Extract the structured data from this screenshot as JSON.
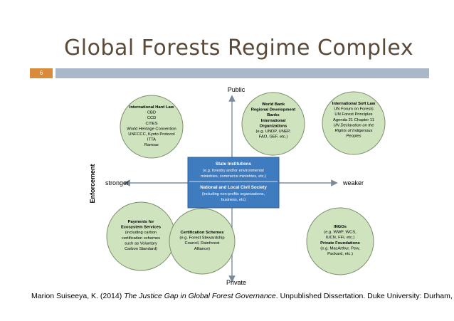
{
  "slide": {
    "title": "Global Forests Regime Complex",
    "number": "6",
    "citation_author": "Marion Suiseeya, K. (2014) ",
    "citation_title": "The Justice Gap in Global Forest Governance",
    "citation_rest": ". Unpublished Dissertation. Duke University: Durham, NC."
  },
  "diagram": {
    "axis_labels": {
      "top": "Public",
      "bottom": "Private",
      "left": "stronger",
      "right": "weaker",
      "vertical": "Enforcement"
    },
    "center_box": {
      "top_title": "State Institutions",
      "top_lines": [
        "(e.g. forestry and/or environmental",
        "ministries, commerce ministries, etc.)"
      ],
      "bottom_title": "National and Local Civil Society",
      "bottom_lines": [
        "(including non-profits organizations,",
        "business, etc)"
      ]
    },
    "circles": [
      {
        "id": "hard-law",
        "lines": [
          "International Hard Law",
          "CBD",
          "CCD",
          "CITES",
          "World Heritage Convention",
          "UNFCCC, Kyoto Protocol",
          "ITTA",
          "Ramsar"
        ]
      },
      {
        "id": "world-bank",
        "lines": [
          "World Bank",
          "Regional Development",
          "Banks",
          "International",
          "Organizations",
          "(e.g. UNDP, UNEP,",
          "FAO, GEF, etc.)"
        ]
      },
      {
        "id": "soft-law",
        "lines": [
          "International Soft Law",
          "UN Forum on Forests",
          "UN Forest Principles",
          "Agenda 21 Chapter 11",
          "UN Declaration on the",
          "Rights of Indigenous",
          "Peoples"
        ]
      },
      {
        "id": "pes",
        "lines": [
          "Payments for",
          "Ecosystem Services",
          "(including carbon",
          "certification schemes",
          "such as Voluntary",
          "Carbon Standard)"
        ]
      },
      {
        "id": "certification",
        "lines": [
          "Certification Schemes",
          "(e.g. Forest Stewardship",
          "Council, Rainforest",
          "Alliance)"
        ]
      },
      {
        "id": "ingos",
        "lines": [
          "INGOs",
          "(e.g. WWF, WCS,",
          "IUCN, FFI, etc.)",
          "Private Foundations",
          "(e.g. MacArthur, Pew,",
          "Packard, etc.)"
        ]
      }
    ],
    "colors": {
      "circle_fill": "#cfe3bf",
      "circle_stroke": "#7a8f6a",
      "center_box": "#3f7bbf",
      "arrow": "#7a8a9a",
      "title": "#5a4a3a",
      "accent": "#d98a3a",
      "bar": "#a9b8c9"
    }
  }
}
